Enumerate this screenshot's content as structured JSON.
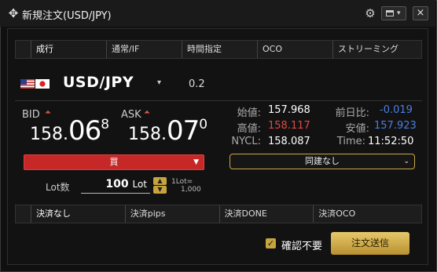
{
  "window": {
    "title": "新規注文(USD/JPY)",
    "close": "×"
  },
  "tabs": [
    "成行",
    "通常/IF",
    "時間指定",
    "OCO",
    "ストリーミング"
  ],
  "pair": {
    "name": "USD/JPY",
    "spread": "0.2"
  },
  "bid": {
    "label": "BID",
    "small": "158.",
    "big": "06",
    "sup": "8"
  },
  "ask": {
    "label": "ASK",
    "small": "158.",
    "big": "07",
    "sup": "0"
  },
  "stats": {
    "open_label": "始値:",
    "open": "157.968",
    "high_label": "高値:",
    "high": "158.117",
    "nycl_label": "NYCL:",
    "nycl": "158.087",
    "change_label": "前日比:",
    "change": "-0.019",
    "low_label": "安値:",
    "low": "157.923",
    "time_label": "Time:",
    "time": "11:52:50"
  },
  "side": "買",
  "condition": "同建なし",
  "lot": {
    "label": "Lot数",
    "value": "100",
    "unit": "Lot",
    "note1": "1Lot=",
    "note2": "1,000"
  },
  "settle_tabs": [
    "決済なし",
    "決済pips",
    "決済DONE",
    "決済OCO"
  ],
  "confirm_label": "確認不要",
  "submit_label": "注文送信",
  "colors": {
    "accent_gold": "#c7a53d",
    "buy_red": "#c62828",
    "up_red": "#e04848",
    "down_blue": "#4a7fe0"
  }
}
